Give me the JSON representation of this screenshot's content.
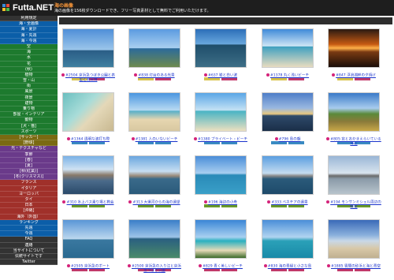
{
  "header": {
    "logo_text": "Futta.NET",
    "title": "海の画像",
    "description": "海の画像を156枚ダウンロードでき、フリー写真素材として無料でご利用いただけます。"
  },
  "sidebar": {
    "items": [
      {
        "label": "利用規定",
        "color": "#333333"
      },
      {
        "label": "海・全画像",
        "color": "#0b5ea8"
      },
      {
        "label": "海・夏計",
        "color": "#0b5ea8"
      },
      {
        "label": "海・先週",
        "color": "#0b5ea8"
      },
      {
        "label": "海・今週",
        "color": "#0b5ea8"
      },
      {
        "label": "空",
        "color": "#1d7a2e"
      },
      {
        "label": "海",
        "color": "#1d7a2e"
      },
      {
        "label": "水",
        "color": "#1d7a2e"
      },
      {
        "label": "花",
        "color": "#1d7a2e"
      },
      {
        "label": "(秋)",
        "color": "#1d7a2e"
      },
      {
        "label": "植物",
        "color": "#1d7a2e"
      },
      {
        "label": "雪・山",
        "color": "#1d7a2e"
      },
      {
        "label": "街",
        "color": "#1d7a2e"
      },
      {
        "label": "風景",
        "color": "#1d7a2e"
      },
      {
        "label": "夜景",
        "color": "#1d7a2e"
      },
      {
        "label": "建物",
        "color": "#1d7a2e"
      },
      {
        "label": "乗り物",
        "color": "#1d7a2e"
      },
      {
        "label": "部屋・インテリア",
        "color": "#1d7a2e"
      },
      {
        "label": "動物",
        "color": "#1d7a2e"
      },
      {
        "label": "[犬・猫]",
        "color": "#1d7a2e"
      },
      {
        "label": "スポーツ",
        "color": "#1d7a2e"
      },
      {
        "label": "[サッカー]",
        "color": "#7a6a12"
      },
      {
        "label": "[野球]",
        "color": "#7a6a12"
      },
      {
        "label": "光・テクスチャなど",
        "color": "#6a3a8a"
      },
      {
        "label": "季節",
        "color": "#6a3a8a"
      },
      {
        "label": "[春]",
        "color": "#6a3a8a"
      },
      {
        "label": "[夏]",
        "color": "#6a3a8a"
      },
      {
        "label": "[秋(紅葉)]",
        "color": "#6a3a8a"
      },
      {
        "label": "[冬(クリスマス)]",
        "color": "#6a3a8a"
      },
      {
        "label": "フランス",
        "color": "#a0302a"
      },
      {
        "label": "イタリア",
        "color": "#a0302a"
      },
      {
        "label": "ヨーロッパ",
        "color": "#a0302a"
      },
      {
        "label": "タイ",
        "color": "#a0302a"
      },
      {
        "label": "日本",
        "color": "#a0302a"
      },
      {
        "label": "[沖縄]",
        "color": "#a0302a"
      },
      {
        "label": "海外（外国）",
        "color": "#a0302a"
      },
      {
        "label": "ランキング",
        "color": "#0b5ea8"
      },
      {
        "label": "先週",
        "color": "#0b5ea8"
      },
      {
        "label": "今週",
        "color": "#0b5ea8"
      },
      {
        "label": "FAQ",
        "color": "#333333"
      },
      {
        "label": "連絡",
        "color": "#333333"
      },
      {
        "label": "当サイトについて",
        "color": "#333333"
      },
      {
        "label": "伝統サイトです",
        "color": "#333333"
      },
      {
        "label": "Twitter",
        "color": "#333333"
      }
    ]
  },
  "main": {
    "page_info": "海：1〜50 (全156枚)",
    "cards": [
      {
        "caption": "#2504 京浜急つぼき公園と表型と雨日傳",
        "thumb": "linear-gradient(#4f8fd8 0%,#9cc6ea 55%,#2a5d86 56%,#3f7fa0 100%)",
        "tags": [
          "#d8c24a",
          "#c23a6a"
        ]
      },
      {
        "caption": "#838 灯台のある光景",
        "thumb": "linear-gradient(#5b9be0 0%,#a9cff0 50%,#2c6a9a 51%,#6d8a4e 100%)",
        "tags": [
          "#d8c24a",
          "#c23a6a"
        ]
      },
      {
        "caption": "#637 岩と白い波",
        "thumb": "linear-gradient(#2c6fb8 0%,#6aa8de 40%,#1e4d6a 41%,#3d6e86 100%)",
        "tags": [
          "#d8c24a",
          "#c23a6a"
        ]
      },
      {
        "caption": "#1378 丸く浅いビーチ",
        "thumb": "linear-gradient(#3f8ad8 0%,#cfe6f5 45%,#3fa0c0 46%,#e8dcc0 100%)",
        "tags": [
          "#d8c24a",
          "#c23a6a"
        ]
      },
      {
        "caption": "#847 浮浪湖畔の夕焼け",
        "thumb": "linear-gradient(#2a1a12 0%,#c65a12 40%,#ffb14a 50%,#7a3a12 60%,#1a0d08 100%)",
        "tags": [
          "#d8c24a",
          "#c23a6a"
        ]
      },
      {
        "caption": "#1364 透明な波打ち際",
        "thumb": "linear-gradient(135deg,#6bbfc0 0%,#a8dcd8 40%,#e4d8b8 60%,#c8b890 100%)",
        "tags": [
          "#3a8ac2",
          "#3a8ac2"
        ]
      },
      {
        "caption": "#1381 人のいないビーチ",
        "thumb": "linear-gradient(#4a96e0 0%,#b8daf2 45%,#5ab0c8 48%,#e6d6b0 70%,#d8c8a0 100%)",
        "tags": [
          "#3a8ac2",
          "#3a8ac2"
        ]
      },
      {
        "caption": "#1380 プライベート・ビーチ",
        "thumb": "linear-gradient(#5aa6e6 0%,#c4e2f4 45%,#4ab4c4 48%,#ece0c0 100%)",
        "tags": [
          "#3a8ac2",
          "#3a8ac2"
        ]
      },
      {
        "caption": "#796 島の朝",
        "thumb": "linear-gradient(#4e7ec8 0%,#9ab8e0 40%,#e8c880 55%,#2e4a6a 60%,#1a2e48 100%)",
        "tags": [
          "#3a8ac2",
          "#3a8ac2"
        ]
      },
      {
        "caption": "#805 窓とおかまえらいている海辺",
        "thumb": "linear-gradient(#3a7ac8 0%,#a8ccee 40%,#5a8a3a 55%,#8a7a3a 75%,#c8a848 100%)",
        "tags": [
          "#3a8ac2",
          "#3a8ac2"
        ]
      },
      {
        "caption": "#310 水上バス乗り場と教会",
        "thumb": "linear-gradient(#7ab2e6 0%,#cfe2f2 35%,#8a7a6a 50%,#4a6a8a 65%,#2a4a6a 100%)",
        "tags": [
          "#6a9a2a",
          "#6a9a2a"
        ]
      },
      {
        "caption": "#313 大運河からの海の遠望",
        "thumb": "linear-gradient(#6aa6de 0%,#c6def2 40%,#9a8a7a 52%,#3a6a8a 60%,#2a5a7a 100%)",
        "tags": [
          "#6a9a2a",
          "#6a9a2a"
        ]
      },
      {
        "caption": "#196 海辺の小舟",
        "thumb": "linear-gradient(#4a8ed8 0%,#a8cef0 45%,#2a8ab8 50%,#3aa0c8 100%)",
        "tags": [
          "#6a9a2a",
          "#6a9a2a"
        ]
      },
      {
        "caption": "#333 ベネチアの遠景",
        "thumb": "linear-gradient(#5a9ee0 0%,#c4dcf0 45%,#8a8a8a 52%,#2a5a7a 60%,#1e4a6a 100%)",
        "tags": [
          "#6a9a2a",
          "#6a9a2a"
        ]
      },
      {
        "caption": "#194 モンサンミシェル周辺の眺望",
        "thumb": "linear-gradient(#9ab6d6 0%,#d8e4ee 45%,#6a6a6a 52%,#8a9aa8 60%,#b8c4cc 100%)",
        "tags": [
          "#6a9a2a",
          "#6a9a2a"
        ]
      },
      {
        "caption": "#2505 京浜急のボート",
        "thumb": "linear-gradient(#5a96d6 0%,#bcd8ee 50%,#3a78a0 52%,#2a6a90 100%)",
        "tags": [
          "#c23a6a",
          "#c23a6a"
        ]
      },
      {
        "caption": "#2500 京浜急の入り江と京浜急つぼき公園",
        "thumb": "linear-gradient(#3a7ec8 0%,#9cc4e8 45%,#2a6080 50%,#4a8a6a 100%)",
        "tags": [
          "#c23a6a",
          "#c23a6a"
        ]
      },
      {
        "caption": "#829 青く美しいビーチ",
        "thumb": "linear-gradient(#3a86d6 0%,#a8d0f0 45%,#2ab0c0 55%,#e6dab8 80%,#3a6a2a 100%)",
        "tags": [
          "#c23a6a",
          "#c23a6a"
        ]
      },
      {
        "caption": "#830 海の青緑と小さな島",
        "thumb": "linear-gradient(#4a8ed8 0%,#b0d4f0 45%,#2aa0b8 55%,#1a8aa8 100%)",
        "tags": [
          "#c23a6a",
          "#c23a6a"
        ]
      },
      {
        "caption": "#1885 雲間の砂浜と海と青空",
        "thumb": "linear-gradient(#3a6ab8 0%,#8ab0dc 40%,#c8d8e8 55%,#d8c8a8 75%,#c0b090 100%)",
        "tags": [
          "#c23a6a",
          "#c23a6a"
        ]
      }
    ]
  }
}
